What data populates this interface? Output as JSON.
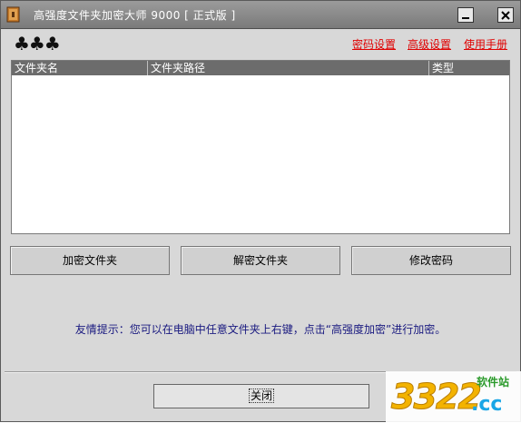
{
  "window": {
    "title": "高强度文件夹加密大师 9000 [ 正式版 ]"
  },
  "toolbar": {
    "decor": "♣♣♣",
    "links": [
      "密码设置",
      "高级设置",
      "使用手册"
    ]
  },
  "table": {
    "columns": [
      "文件夹名",
      "文件夹路径",
      "类型"
    ],
    "rows": []
  },
  "actions": {
    "encrypt": "加密文件夹",
    "decrypt": "解密文件夹",
    "change_password": "修改密码"
  },
  "tip": "友情提示：您可以在电脑中任意文件夹上右键，点击“高强度加密”进行加密。",
  "footer": {
    "close": "关闭"
  },
  "watermark": {
    "number": "3322",
    "domain": ".cc",
    "site": "软件站"
  },
  "colors": {
    "titlebar": "#8a8a8a",
    "link": "#e00000",
    "header": "#6c6c6c"
  }
}
